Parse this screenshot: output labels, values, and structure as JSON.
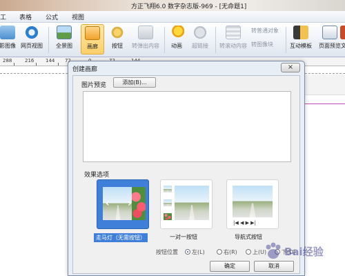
{
  "app": {
    "title": "方正飞翔6.0 数字杂志版-969 - [无命题1]"
  },
  "menu": {
    "items": [
      "工",
      "表格",
      "公式",
      "视图"
    ]
  },
  "ribbon": {
    "buttons": [
      {
        "label": "影图像",
        "icon": "image-icon",
        "enabled": true
      },
      {
        "label": "网页视图",
        "icon": "web-view-icon",
        "enabled": true
      },
      {
        "label": "全景图",
        "icon": "panorama-icon",
        "enabled": true
      },
      {
        "label": "画廊",
        "icon": "gallery-icon",
        "enabled": true,
        "selected": true
      },
      {
        "label": "按钮",
        "icon": "button-icon",
        "enabled": true
      },
      {
        "label": "转弹出内容",
        "icon": "popup-icon",
        "enabled": false
      },
      {
        "label": "动画",
        "icon": "animation-icon",
        "enabled": true
      },
      {
        "label": "超链接",
        "icon": "hyperlink-icon",
        "enabled": false
      },
      {
        "label": "转滚动内容",
        "icon": "scroll-content-icon",
        "enabled": false
      },
      {
        "label": "互动模板",
        "icon": "interactive-template-icon",
        "enabled": true
      },
      {
        "label": "页面预览",
        "icon": "page-preview-icon",
        "enabled": true
      },
      {
        "label": "文",
        "icon": "text-icon",
        "enabled": true
      }
    ],
    "small_items": [
      "转普通对象",
      "转图像块"
    ]
  },
  "ruler": {
    "labels": [
      "288",
      "216",
      "144",
      "72",
      "0",
      "72",
      "144"
    ]
  },
  "dialog": {
    "title": "创建画廊",
    "close_symbol": "×",
    "preview_label": "图片预览",
    "add_button": "添加(B)...",
    "effects_label": "效果选项",
    "options": [
      {
        "label": "走马灯（无需按钮）",
        "selected": true
      },
      {
        "label": "一对一按钮",
        "selected": false
      },
      {
        "label": "导航式按钮",
        "selected": false
      }
    ],
    "nav_symbols": "|◀ ◀ ▶ ▶|",
    "position_label": "按钮位置",
    "position_options": [
      {
        "label": "左(L)",
        "checked": true
      },
      {
        "label": "右(R)",
        "checked": false
      },
      {
        "label": "上(U)",
        "checked": false
      },
      {
        "label": "下(D)",
        "checked": false
      }
    ],
    "ok_button": "确定",
    "cancel_button": "取消"
  },
  "watermark": {
    "text": "Bai经验"
  },
  "colors": {
    "selection_blue": "#3f7fd9",
    "ribbon_selected": "#fbd06b",
    "canvas_guide": "#c04dc0"
  }
}
